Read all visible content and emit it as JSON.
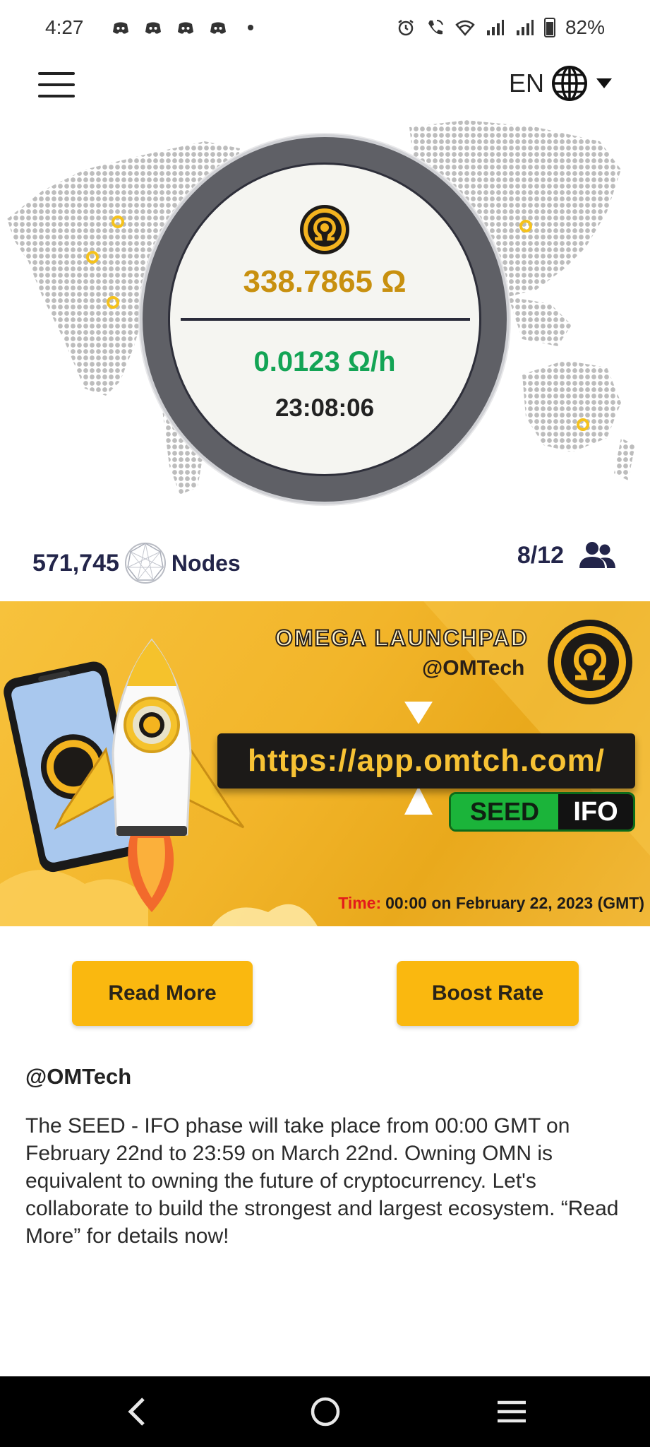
{
  "status_bar": {
    "time": "4:27",
    "battery": "82%",
    "notification_icons": [
      "discord-icon",
      "discord-icon",
      "discord-icon",
      "discord-icon",
      "dot-icon"
    ],
    "system_icons": [
      "alarm-icon",
      "wifi-calling-icon",
      "wifi-icon",
      "signal-icon",
      "signal-icon",
      "battery-icon"
    ]
  },
  "header": {
    "language": "EN"
  },
  "miner": {
    "balance": "338.7865 Ω",
    "rate": "0.0123 Ω/h",
    "countdown": "23:08:06"
  },
  "stats": {
    "nodes_count": "571,745",
    "nodes_label": "Nodes",
    "team": "8/12"
  },
  "banner": {
    "title": "OMEGA LAUNCHPAD",
    "handle": "@OMTech",
    "url": "https://app.omtch.com/",
    "seed_label": "SEED",
    "ifo_label": "IFO",
    "time_label": "Time:",
    "time_value": "00:00 on February 22, 2023 (GMT)"
  },
  "actions": {
    "read_more": "Read More",
    "boost_rate": "Boost Rate"
  },
  "post": {
    "author": "@OMTech",
    "body": "The SEED - IFO phase will take place from 00:00 GMT on February 22nd to 23:59 on March 22nd. Owning OMN is equivalent to owning the future of cryptocurrency. Let's collaborate to build the strongest and largest ecosystem. “Read More” for details now!"
  },
  "colors": {
    "accent": "#fab80f",
    "balance": "#c8900f",
    "rate": "#13a455",
    "navy": "#23254a"
  }
}
